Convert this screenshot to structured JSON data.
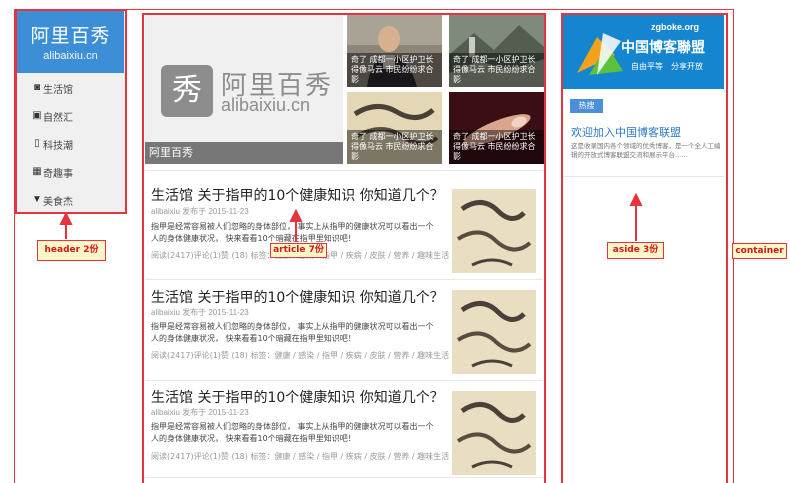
{
  "header": {
    "logo_title": "阿里百秀",
    "logo_sub": "alibaixiu.cn",
    "nav": [
      {
        "icon": "camera-icon",
        "glyph": "◙",
        "label": "生活馆"
      },
      {
        "icon": "image-icon",
        "glyph": "▣",
        "label": "自然汇"
      },
      {
        "icon": "phone-icon",
        "glyph": "▯",
        "label": "科技潮"
      },
      {
        "icon": "grid-icon",
        "glyph": "▦",
        "label": "奇趣事"
      },
      {
        "icon": "filter-icon",
        "glyph": "▼",
        "label": "美食杰"
      }
    ]
  },
  "banner": {
    "mark": "秀",
    "title": "阿里百秀",
    "sub": "alibaixiu.cn",
    "caption": "阿里百秀"
  },
  "thumbs": [
    {
      "caption": "奇了 成都一小区护卫长得像马云 市民纷纷求合影"
    },
    {
      "caption": "奇了 成都一小区护卫长得像马云 市民纷纷求合影"
    },
    {
      "caption": "奇了 成都一小区护卫长得像马云 市民纷纷求合影"
    },
    {
      "caption": "奇了 成都一小区护卫长得像马云 市民纷纷求合影"
    }
  ],
  "posts": [
    {
      "title": "生活馆 关于指甲的10个健康知识 你知道几个？",
      "meta": "alibaixiu 发布于 2015-11-23",
      "desc": "指甲是经常容易被人们忽略的身体部位， 事实上从指甲的健康状况可以看出一个人的身体健康状况， 快来看看10个暗藏在指甲里知识吧！",
      "stats": "阅读(2417)评论(1)赞 (18) 标签：健康 / 感染 / 指甲 / 疾病 / 皮肤 / 营养 / 趣味生活"
    },
    {
      "title": "生活馆 关于指甲的10个健康知识 你知道几个？",
      "meta": "alibaixiu 发布于 2015-11-23",
      "desc": "指甲是经常容易被人们忽略的身体部位， 事实上从指甲的健康状况可以看出一个人的身体健康状况， 快来看看10个暗藏在指甲里知识吧！",
      "stats": "阅读(2417)评论(1)赞 (18) 标签：健康 / 感染 / 指甲 / 疾病 / 皮肤 / 营养 / 趣味生活"
    },
    {
      "title": "生活馆 关于指甲的10个健康知识 你知道几个？",
      "meta": "alibaixiu 发布于 2015-11-23",
      "desc": "指甲是经常容易被人们忽略的身体部位， 事实上从指甲的健康状况可以看出一个人的身体健康状况， 快来看看10个暗藏在指甲里知识吧！",
      "stats": "阅读(2417)评论(1)赞 (18) 标签：健康 / 感染 / 指甲 / 疾病 / 皮肤 / 营养 / 趣味生活"
    }
  ],
  "aside": {
    "banner_url": "zgboke.org",
    "banner_name": "中国博客聯盟",
    "banner_slogan": "自由平等　分享开放",
    "tag": "热搜",
    "title": "欢迎加入中国博客联盟",
    "desc": "这是收录国内各个领域的优秀博客，是一个全人工编辑的开放式博客联盟交流和展示平台......"
  },
  "annotations": {
    "header": "header 2份",
    "article": "article 7份",
    "aside": "aside 3份",
    "container": "container"
  },
  "colors": {
    "annotation_red": "#e5343d",
    "logo_blue": "#3c8fd6",
    "link_blue": "#2b78c5",
    "annotation_fill": "#fff7c7"
  }
}
